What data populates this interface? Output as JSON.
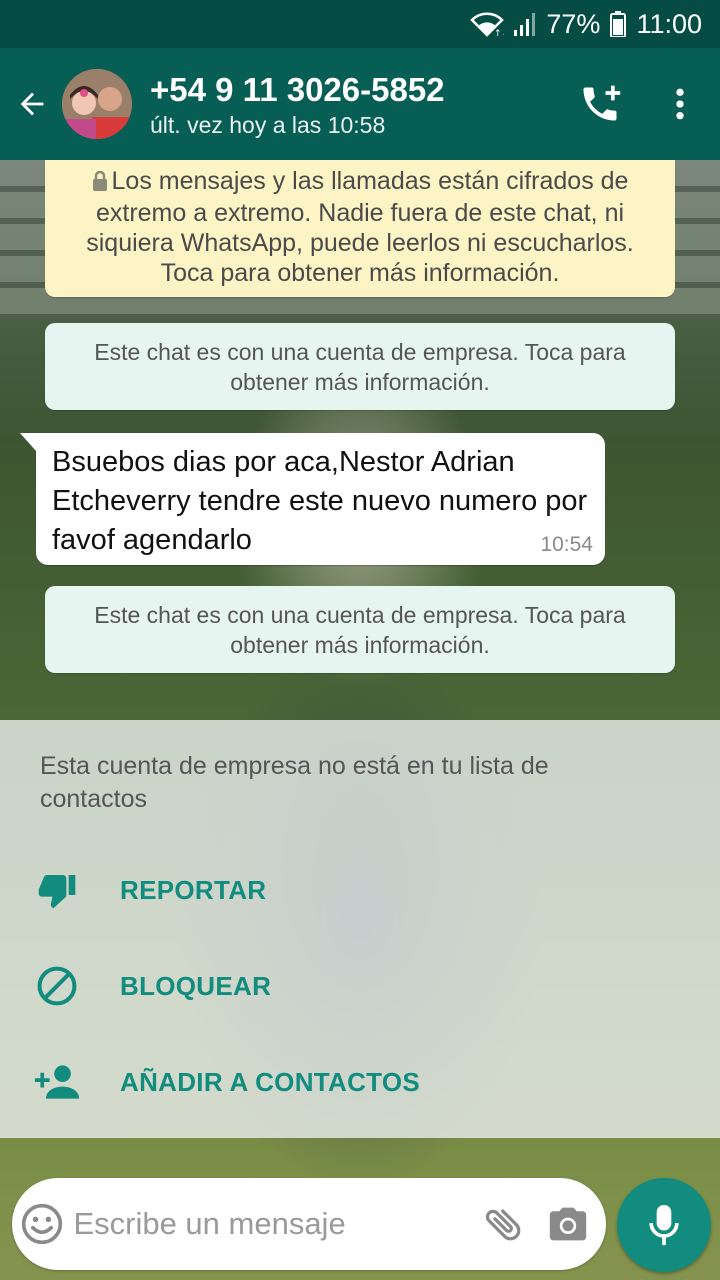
{
  "status_bar": {
    "battery": "77%",
    "time": "11:00"
  },
  "header": {
    "contact_title": "+54 9 11 3026-5852",
    "last_seen": "últ. vez hoy a las 10:58"
  },
  "chat": {
    "encryption_notice": "Los mensajes y las llamadas están cifrados de extremo a extremo. Nadie fuera de este chat, ni siquiera WhatsApp, puede leerlos ni escucharlos. Toca para obtener más información.",
    "business_notice_1": "Este chat es con una cuenta de empresa. Toca para obtener más información.",
    "messages": [
      {
        "text": "Bsuebos dias por aca,Nestor Adrian Etcheverry tendre este nuevo numero por favof agendarlo",
        "time": "10:54"
      }
    ],
    "business_notice_2": "Este chat es con una cuenta de empresa. Toca para obtener más información."
  },
  "business_panel": {
    "note": "Esta cuenta de empresa no está en tu lista de contactos",
    "actions": [
      {
        "label": "REPORTAR",
        "icon": "thumb-down-icon"
      },
      {
        "label": "BLOQUEAR",
        "icon": "block-icon"
      },
      {
        "label": "AÑADIR A CONTACTOS",
        "icon": "add-person-icon"
      }
    ]
  },
  "composer": {
    "placeholder": "Escribe un mensaje"
  },
  "colors": {
    "status_bar": "#054d44",
    "app_bar": "#075e54",
    "accent": "#128c7e",
    "system_yellow": "#fdf4c5",
    "system_green": "#e6f5f0"
  }
}
